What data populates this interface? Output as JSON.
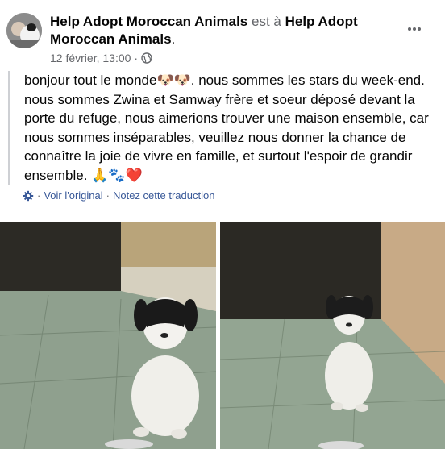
{
  "post": {
    "author": "Help Adopt Moroccan Animals",
    "connector": "est à",
    "location_line1": "Help Adopt",
    "location_line2": "Moroccan Animals",
    "period": ".",
    "date": "12 février, 13:00",
    "separator": "·",
    "body_text": "bonjour tout le monde🐶🐶. nous sommes les stars du week-end. nous sommes Zwina et Samway frère et soeur déposé devant la porte du refuge, nous aimerions trouver une maison ensemble, car nous sommes inséparables, veuillez nous donner la chance de connaître la joie de vivre en famille, et surtout l'espoir de grandir ensemble. 🙏🐾❤️"
  },
  "translation": {
    "view_original": "Voir l'original",
    "dot": "·",
    "rate": "Notez cette traduction"
  },
  "icons": {
    "more": "more-horizontal-icon",
    "privacy": "globe-icon",
    "translate": "gear-icon"
  },
  "colors": {
    "link": "#385898",
    "secondary": "#65676b",
    "quote_bar": "#ced0d4"
  }
}
